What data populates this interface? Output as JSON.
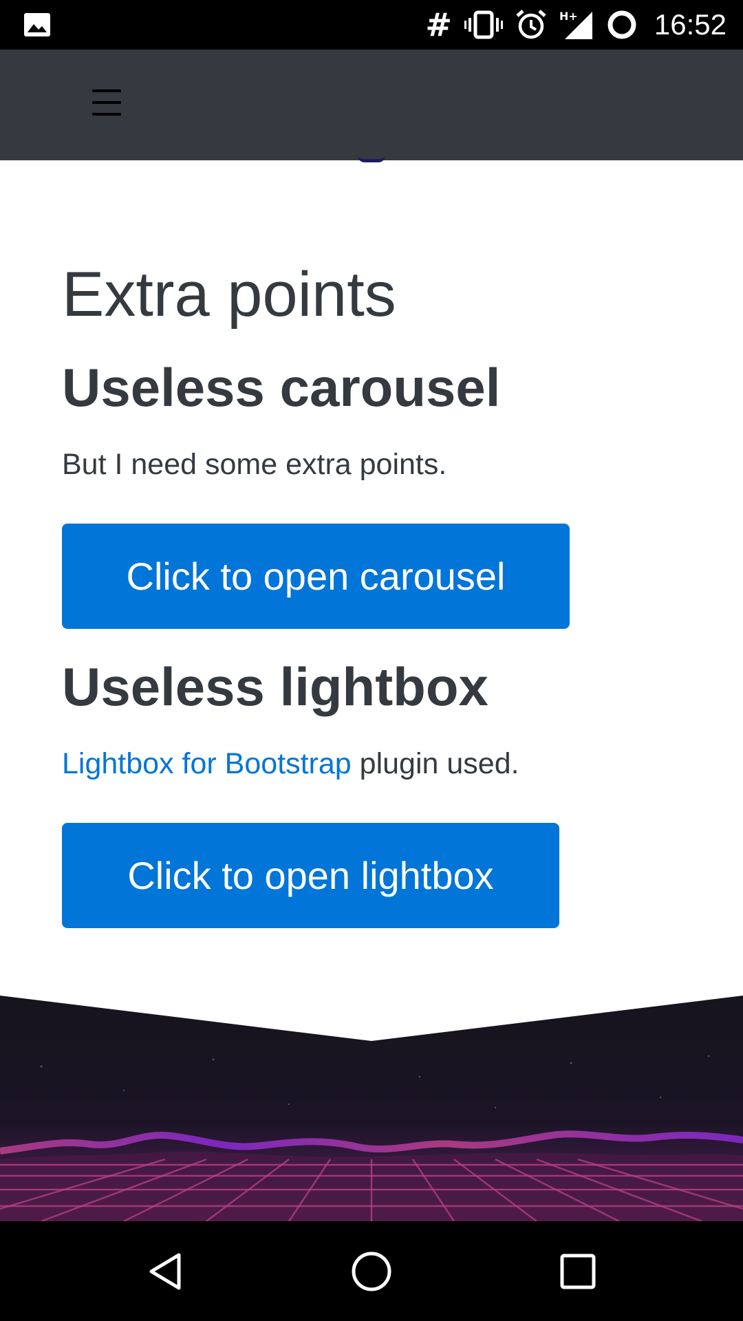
{
  "status_bar": {
    "time": "16:52",
    "hash_glyph": "#",
    "icons": [
      "image-icon",
      "vibrate-icon",
      "alarm-icon",
      "signal-hplus-icon",
      "sync-circle-icon"
    ]
  },
  "navbar": {
    "menu_icon": "hamburger-menu-icon"
  },
  "main": {
    "title": "Extra points",
    "carousel": {
      "heading": "Useless carousel",
      "text": "But I need some extra points.",
      "button_label": "Click to open carousel"
    },
    "lightbox": {
      "heading": "Useless lightbox",
      "link_text": "Lightbox for Bootstrap",
      "text_suffix": " plugin used.",
      "button_label": "Click to open lightbox"
    }
  },
  "colors": {
    "navbar_bg": "#343a40",
    "primary": "#0275d8",
    "text": "#343a40",
    "footer_bg": "#16141e",
    "synth_pink": "#c0408c",
    "synth_purple": "#8a2bd8"
  },
  "nav_bar": {
    "icons": [
      "back-icon",
      "home-icon",
      "recents-icon"
    ]
  }
}
